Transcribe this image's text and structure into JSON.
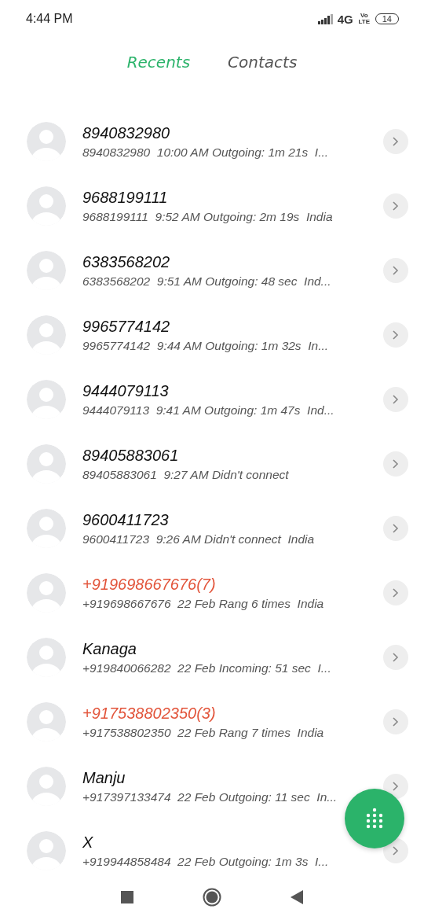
{
  "status_bar": {
    "time": "4:44 PM",
    "network": "4G",
    "volte": "Vo LTE",
    "battery": "14"
  },
  "tabs": [
    {
      "label": "Recents",
      "selected": true
    },
    {
      "label": "Contacts",
      "selected": false
    }
  ],
  "calls": [
    {
      "name": "8940832980",
      "detail": "8940832980  10:00 AM Outgoing: 1m 21s  I...",
      "missed": false
    },
    {
      "name": "9688199111",
      "detail": "9688199111  9:52 AM Outgoing: 2m 19s  India",
      "missed": false
    },
    {
      "name": "6383568202",
      "detail": "6383568202  9:51 AM Outgoing: 48 sec  Ind...",
      "missed": false
    },
    {
      "name": "9965774142",
      "detail": "9965774142  9:44 AM Outgoing: 1m 32s  In...",
      "missed": false
    },
    {
      "name": "9444079113",
      "detail": "9444079113  9:41 AM Outgoing: 1m 47s  Ind...",
      "missed": false
    },
    {
      "name": "89405883061",
      "detail": "89405883061  9:27 AM Didn't connect",
      "missed": false
    },
    {
      "name": "9600411723",
      "detail": "9600411723  9:26 AM Didn't connect  India",
      "missed": false
    },
    {
      "name": "+919698667676(7)",
      "detail": "+919698667676  22 Feb Rang 6 times  India",
      "missed": true
    },
    {
      "name": "Kanaga",
      "detail": "+919840066282  22 Feb Incoming: 51 sec  I...",
      "missed": false
    },
    {
      "name": "+917538802350(3)",
      "detail": "+917538802350  22 Feb Rang 7 times  India",
      "missed": true
    },
    {
      "name": "Manju",
      "detail": "+917397133474  22 Feb Outgoing: 11 sec  In...",
      "missed": false
    },
    {
      "name": "X",
      "detail": "+919944858484  22 Feb Outgoing: 1m 3s  I...",
      "missed": false
    }
  ]
}
